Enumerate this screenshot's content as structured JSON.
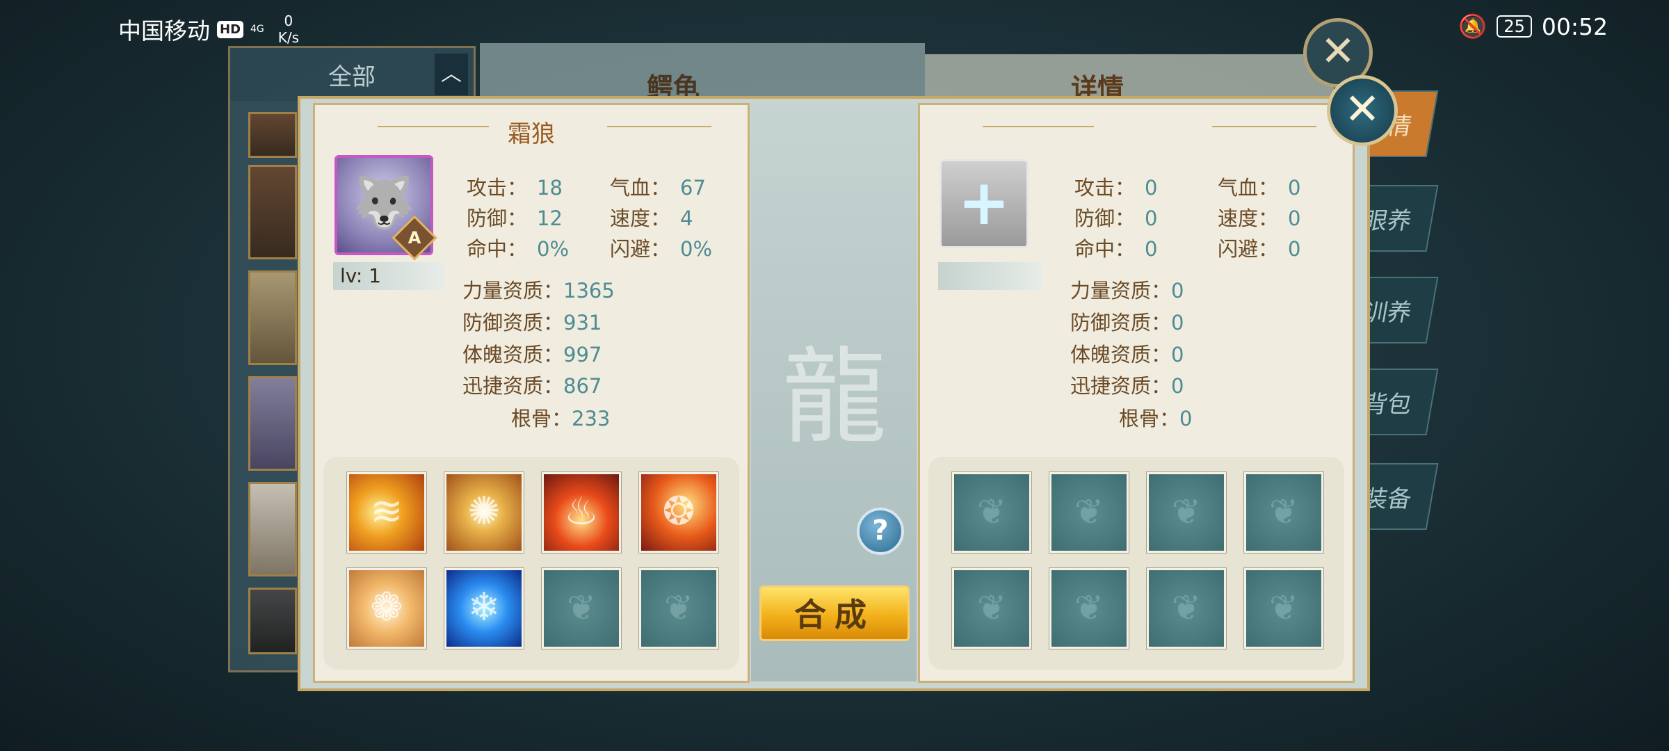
{
  "status_bar": {
    "carrier": "中国移动",
    "hd": "HD",
    "signal": "4G",
    "net_speed_value": "0",
    "net_speed_unit": "K/s",
    "battery": "25",
    "time": "00:52"
  },
  "background": {
    "list_header": "全部",
    "main_title": "鳄龟",
    "detail_title": "详情",
    "side_tabs": [
      "情",
      "眼养",
      "训养",
      "背包",
      "装备"
    ]
  },
  "left_pet": {
    "name": "霜狼",
    "grade": "A",
    "level": "lv: 1",
    "stats": [
      {
        "label": "攻击：",
        "value": "18"
      },
      {
        "label": "气血：",
        "value": "67"
      },
      {
        "label": "防御：",
        "value": "12"
      },
      {
        "label": "速度：",
        "value": "4"
      },
      {
        "label": "命中：",
        "value": "0%"
      },
      {
        "label": "闪避：",
        "value": "0%"
      }
    ],
    "aptitudes": [
      {
        "label": "力量资质：",
        "value": "1365"
      },
      {
        "label": "防御资质：",
        "value": "931"
      },
      {
        "label": "体魄资质：",
        "value": "997"
      },
      {
        "label": "迅捷资质：",
        "value": "867"
      },
      {
        "label": "根骨：",
        "value": "233"
      }
    ],
    "skill_icons": [
      "claw-strike-icon",
      "sun-wheel-icon",
      "fire-icon",
      "flame-tiger-icon",
      "golden-lion-icon",
      "ice-beast-icon",
      "empty-slot-icon",
      "empty-slot-icon"
    ]
  },
  "right_pet": {
    "add_symbol": "+",
    "stats": [
      {
        "label": "攻击：",
        "value": "0"
      },
      {
        "label": "气血：",
        "value": "0"
      },
      {
        "label": "防御：",
        "value": "0"
      },
      {
        "label": "速度：",
        "value": "0"
      },
      {
        "label": "命中：",
        "value": "0"
      },
      {
        "label": "闪避：",
        "value": "0"
      }
    ],
    "aptitudes": [
      {
        "label": "力量资质：",
        "value": "0"
      },
      {
        "label": "防御资质：",
        "value": "0"
      },
      {
        "label": "体魄资质：",
        "value": "0"
      },
      {
        "label": "迅捷资质：",
        "value": "0"
      },
      {
        "label": "根骨：",
        "value": "0"
      }
    ]
  },
  "center": {
    "help": "?",
    "compose_button": "合成"
  }
}
